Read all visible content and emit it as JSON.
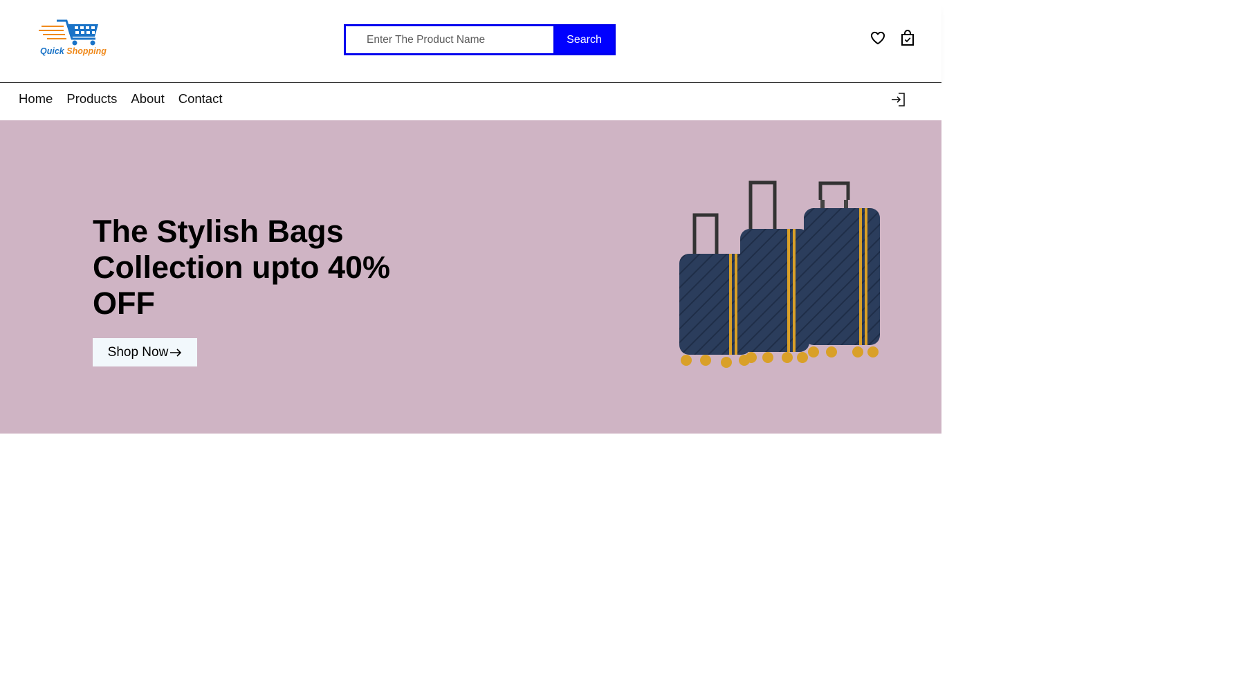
{
  "brand": {
    "logo_word1": "Quick",
    "logo_word2": "Shopping"
  },
  "search": {
    "placeholder": "Enter The Product Name",
    "value": "",
    "button_label": "Search"
  },
  "header_icons": [
    "heart-icon",
    "shopping-bag-icon"
  ],
  "nav": {
    "items": [
      {
        "label": "Home"
      },
      {
        "label": "Products"
      },
      {
        "label": "About"
      },
      {
        "label": "Contact"
      }
    ],
    "right_icon": "login-icon"
  },
  "hero": {
    "title": "The Stylish Bags Collection upto 40% OFF",
    "cta_label": "Shop Now",
    "cta_icon": "arrow-right-icon",
    "image": "luggage-set"
  },
  "colors": {
    "accent": "#0000ff",
    "hero_bg": "#cfb4c4",
    "logo_blue": "#1a73c7",
    "logo_orange": "#f08a1c",
    "cta_bg": "#f2f8fc"
  }
}
